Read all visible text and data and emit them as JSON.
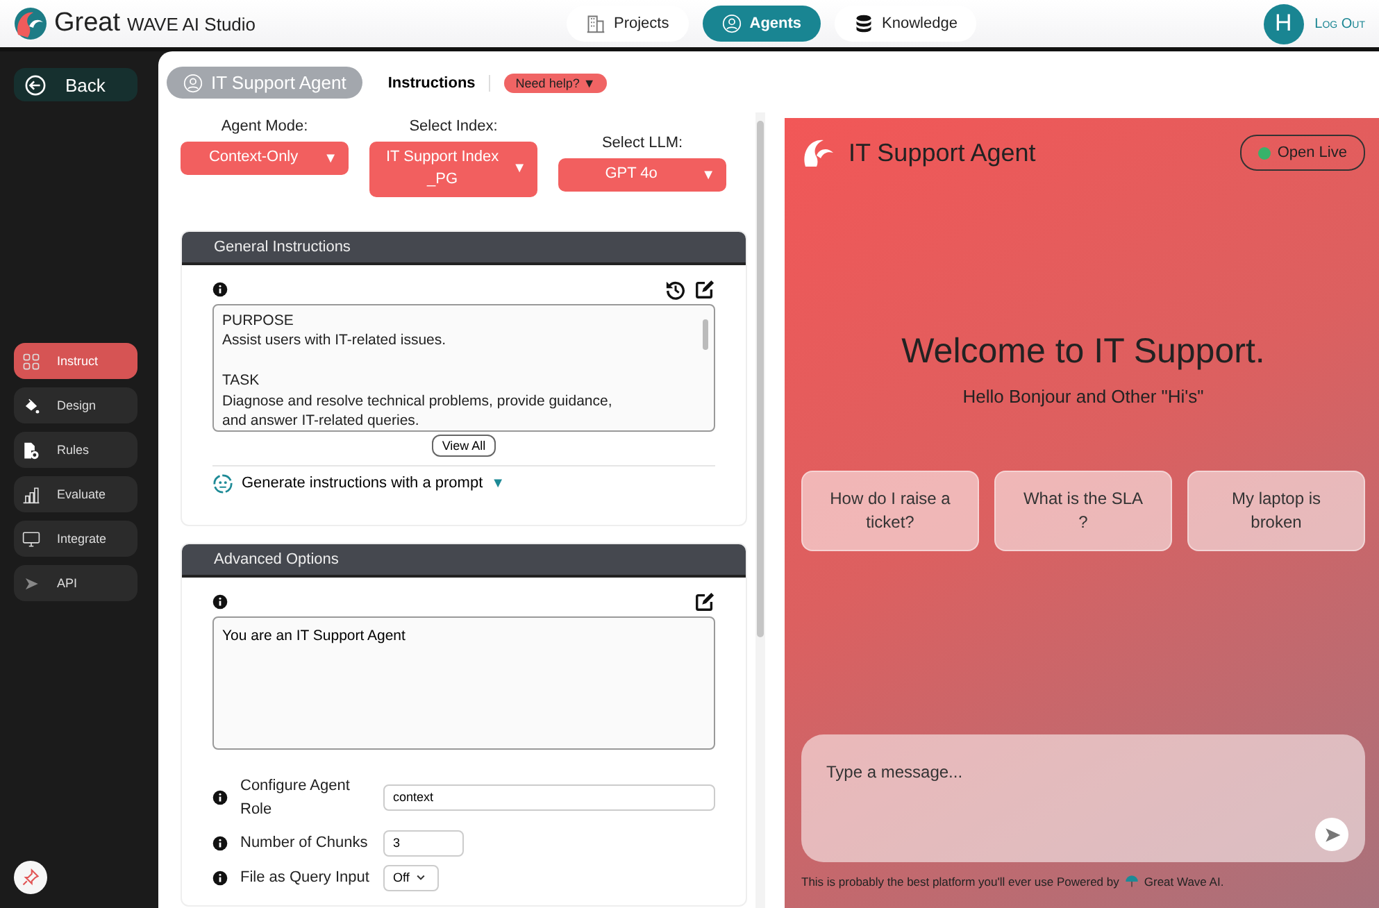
{
  "header": {
    "brand": "Great",
    "brand_sub": "WAVE AI Studio",
    "nav": [
      {
        "label": "Projects",
        "selected": false
      },
      {
        "label": "Agents",
        "selected": true
      },
      {
        "label": "Knowledge",
        "selected": false
      }
    ],
    "avatar": "H",
    "logout": "Log Out"
  },
  "sidebar": {
    "back": "Back",
    "items": [
      {
        "label": "Instruct",
        "selected": true
      },
      {
        "label": "Design",
        "selected": false
      },
      {
        "label": "Rules",
        "selected": false
      },
      {
        "label": "Evaluate",
        "selected": false
      },
      {
        "label": "Integrate",
        "selected": false
      },
      {
        "label": "API",
        "selected": false
      }
    ]
  },
  "agent_bar": {
    "agent": "IT Support Agent",
    "tab": "Instructions",
    "help": "Need help? ▼"
  },
  "selectors": [
    {
      "label": "Agent Mode:",
      "value": "Context-Only",
      "caret": "▼"
    },
    {
      "label": "Select Index:",
      "value": "IT Support Index _PG",
      "caret": "▼"
    },
    {
      "label": "Select LLM:",
      "value": "GPT 4o",
      "caret": "▼"
    }
  ],
  "general_instructions": {
    "title": "General Instructions",
    "paragraphs": [
      [
        "PURPOSE",
        "Assist users with IT-related issues."
      ],
      [
        "TASK",
        "Diagnose and resolve technical problems, provide guidance,",
        "and answer IT-related queries."
      ]
    ],
    "view_all": "View All",
    "generate": "Generate instructions with a prompt",
    "generate_caret": "▼"
  },
  "advanced_options": {
    "title": "Advanced Options",
    "text": "You are an IT Support Agent",
    "fields": [
      {
        "kind": "text",
        "label": "Configure Agent Role",
        "value": "context"
      },
      {
        "kind": "number",
        "label": "Number of Chunks",
        "value": "3"
      },
      {
        "kind": "select",
        "label": "File as Query Input",
        "value": "Off"
      }
    ]
  },
  "preview": {
    "title": "IT Support Agent",
    "open_live": "Open Live",
    "live": true,
    "welcome": "Welcome to IT Support.",
    "subtitle": "Hello Bonjour and Other \"Hi's\"",
    "suggestions": [
      "How do I raise a ticket?",
      "What is the SLA ?",
      "My laptop is broken"
    ],
    "placeholder": "Type a message...",
    "footer": "This is probably the best platform you'll ever use Powered by",
    "footer_brand": "Great Wave AI."
  }
}
